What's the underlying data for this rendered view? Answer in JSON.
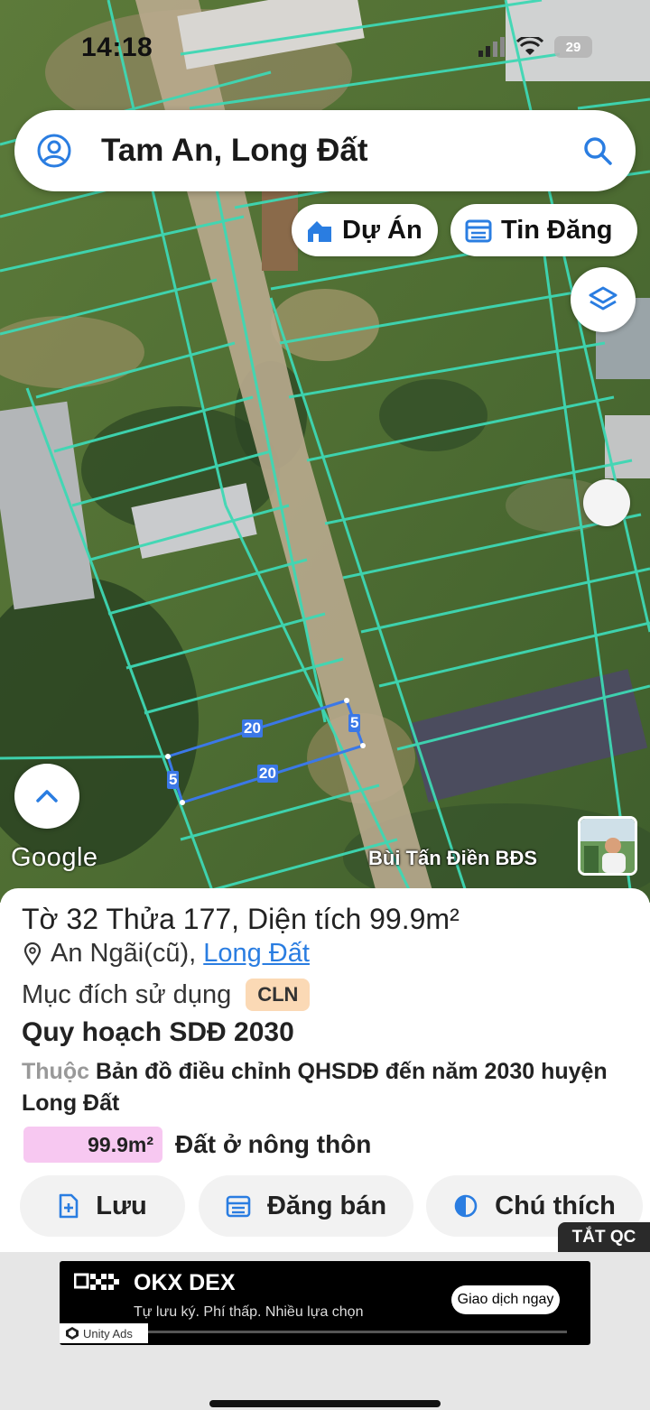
{
  "status_bar": {
    "time": "14:18",
    "battery": "29"
  },
  "search": {
    "query": "Tam An, Long Đất"
  },
  "map_buttons": {
    "projects_label": "Dự Án",
    "listings_label": "Tin Đăng"
  },
  "map": {
    "google_label": "Google",
    "watermark": "Bùi Tấn Điền BĐS",
    "parcel_dimensions": {
      "top": "20",
      "bottom": "20",
      "left": "5",
      "right": "5"
    }
  },
  "parcel": {
    "title": "Tờ 32 Thửa 177, Diện tích 99.9m²",
    "location_prefix": "An Ngãi(cũ), ",
    "location_link": "Long Đất",
    "purpose_label": "Mục đích sử dụng",
    "purpose_code": "CLN",
    "plan_title": "Quy hoạch SDĐ 2030",
    "belongs_prefix": "Thuộc",
    "belongs_text": " Bản đồ điều chỉnh QHSDĐ đến năm 2030 huyện Long Đất",
    "area_value": "99.9m²",
    "area_type": "Đất ở nông thôn"
  },
  "actions": {
    "save": "Lưu",
    "post_sale": "Đăng bán",
    "legend": "Chú thích"
  },
  "ads_off_label": "TẮT QC",
  "ad": {
    "title": "OKX DEX",
    "subtitle": "Tự lưu ký. Phí thấp. Nhiều lựa chọn",
    "cta": "Giao dịch ngay",
    "provider": "Unity Ads"
  },
  "colors": {
    "parcel_lines": "#3ed8b4",
    "selection": "#3b78e7",
    "link": "#2a7de1",
    "cln_badge": "#fbd9b5",
    "area_chip": "#f7c8f1"
  }
}
